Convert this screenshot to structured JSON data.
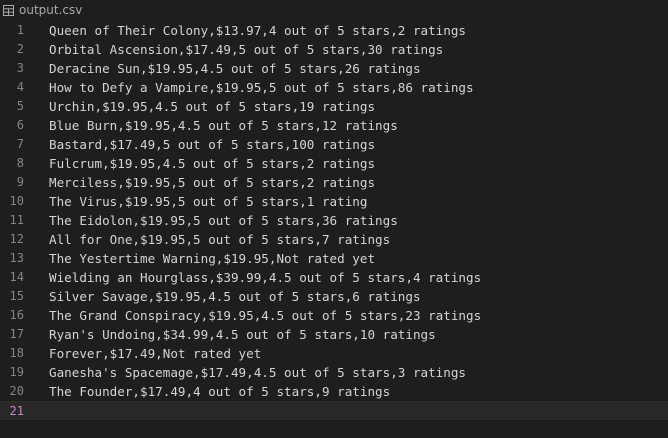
{
  "tab": {
    "filename": "output.csv",
    "icon": "table-file-icon"
  },
  "editor": {
    "current_line": 21,
    "lines": [
      {
        "number": "1",
        "text": "Queen of Their Colony,$13.97,4 out of 5 stars,2 ratings"
      },
      {
        "number": "2",
        "text": "Orbital Ascension,$17.49,5 out of 5 stars,30 ratings"
      },
      {
        "number": "3",
        "text": "Deracine Sun,$19.95,4.5 out of 5 stars,26 ratings"
      },
      {
        "number": "4",
        "text": "How to Defy a Vampire,$19.95,5 out of 5 stars,86 ratings"
      },
      {
        "number": "5",
        "text": "Urchin,$19.95,4.5 out of 5 stars,19 ratings"
      },
      {
        "number": "6",
        "text": "Blue Burn,$19.95,4.5 out of 5 stars,12 ratings"
      },
      {
        "number": "7",
        "text": "Bastard,$17.49,5 out of 5 stars,100 ratings"
      },
      {
        "number": "8",
        "text": "Fulcrum,$19.95,4.5 out of 5 stars,2 ratings"
      },
      {
        "number": "9",
        "text": "Merciless,$19.95,5 out of 5 stars,2 ratings"
      },
      {
        "number": "10",
        "text": "The Virus,$19.95,5 out of 5 stars,1 rating"
      },
      {
        "number": "11",
        "text": "The Eidolon,$19.95,5 out of 5 stars,36 ratings"
      },
      {
        "number": "12",
        "text": "All for One,$19.95,5 out of 5 stars,7 ratings"
      },
      {
        "number": "13",
        "text": "The Yestertime Warning,$19.95,Not rated yet"
      },
      {
        "number": "14",
        "text": "Wielding an Hourglass,$39.99,4.5 out of 5 stars,4 ratings"
      },
      {
        "number": "15",
        "text": "Silver Savage,$19.95,4.5 out of 5 stars,6 ratings"
      },
      {
        "number": "16",
        "text": "The Grand Conspiracy,$19.95,4.5 out of 5 stars,23 ratings"
      },
      {
        "number": "17",
        "text": "Ryan's Undoing,$34.99,4.5 out of 5 stars,10 ratings"
      },
      {
        "number": "18",
        "text": "Forever,$17.49,Not rated yet"
      },
      {
        "number": "19",
        "text": "Ganesha's Spacemage,$17.49,4.5 out of 5 stars,3 ratings"
      },
      {
        "number": "20",
        "text": "The Founder,$17.49,4 out of 5 stars,9 ratings"
      },
      {
        "number": "21",
        "text": ""
      }
    ]
  },
  "colors": {
    "background": "#1e1e1e",
    "text": "#d4d4d4",
    "line_number": "#858585",
    "current_line_number": "#c586c0"
  }
}
